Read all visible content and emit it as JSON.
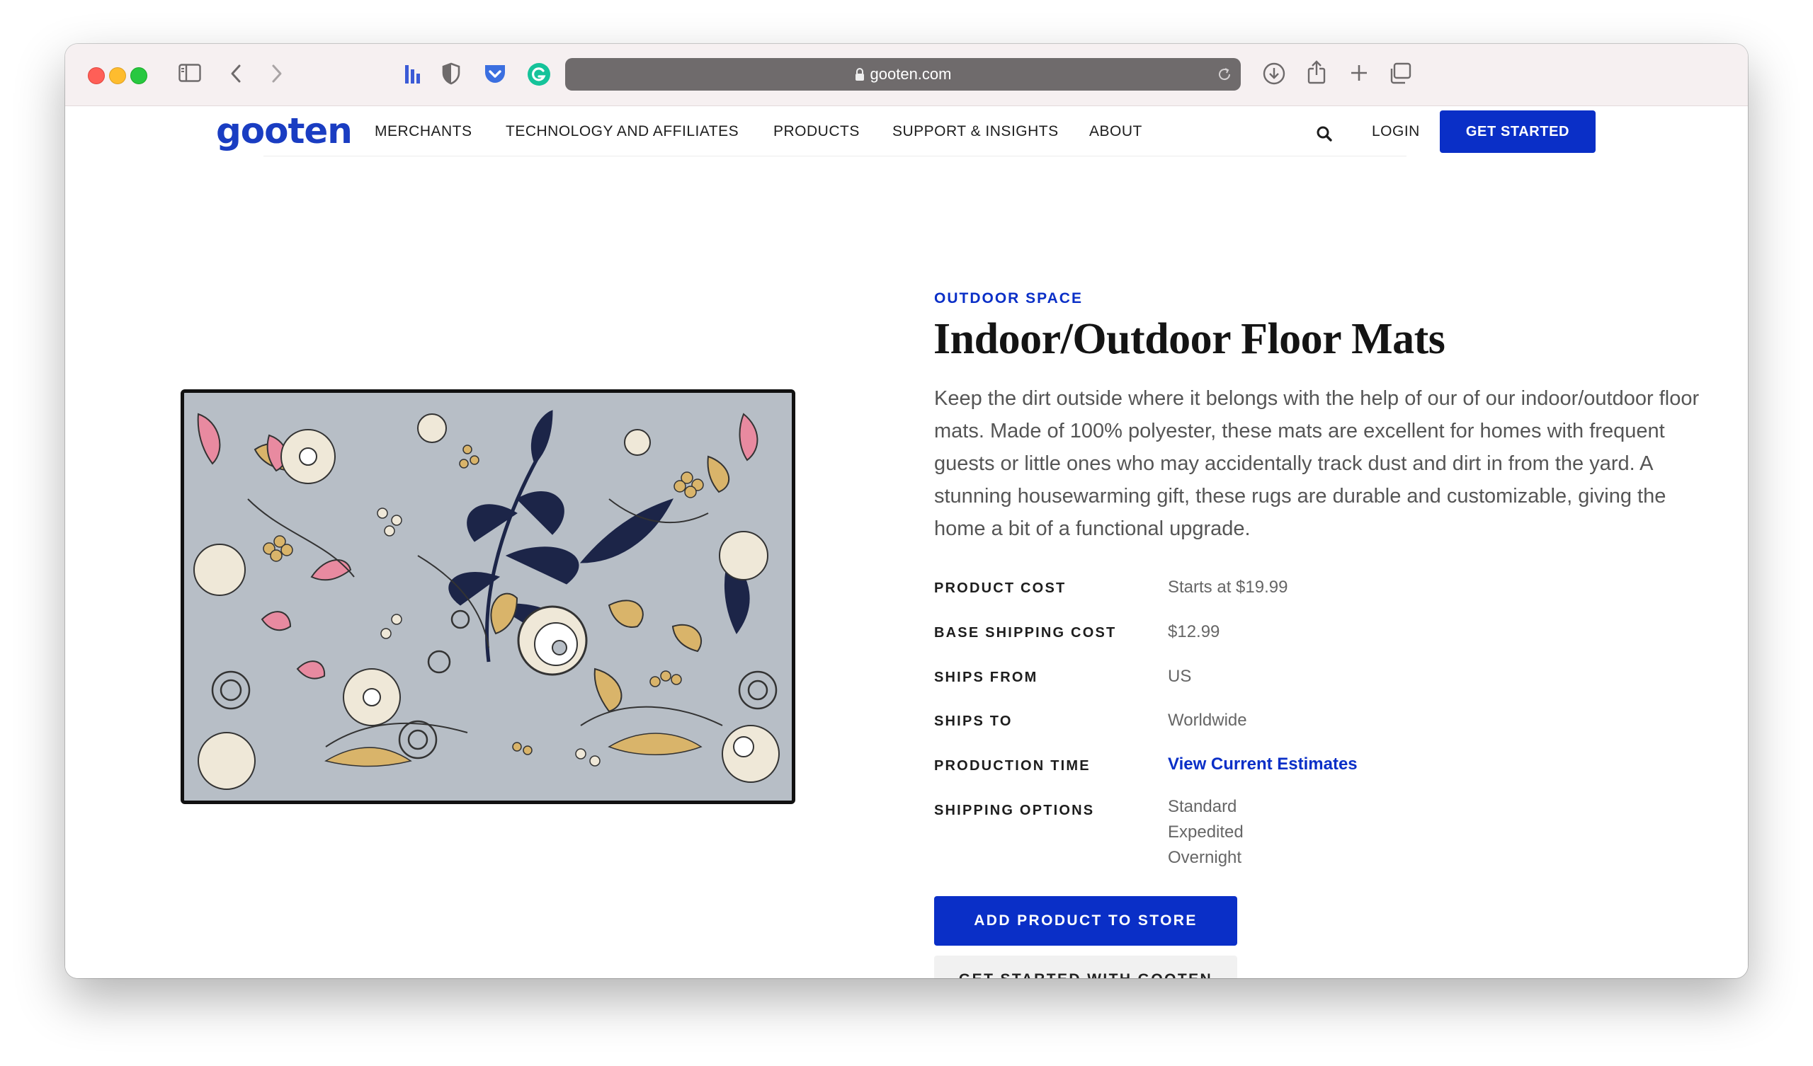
{
  "browser": {
    "url": "gooten.com",
    "icons": [
      "sidebar-icon",
      "back-icon",
      "forward-icon",
      "bookmark-icon",
      "shield-icon",
      "pocket-icon",
      "grammarly-icon",
      "lock-icon",
      "reload-icon",
      "download-icon",
      "share-icon",
      "new-tab-icon",
      "tabs-overview-icon"
    ]
  },
  "header": {
    "logo": "gooten",
    "nav": [
      "MERCHANTS",
      "TECHNOLOGY AND AFFILIATES",
      "PRODUCTS",
      "SUPPORT & INSIGHTS",
      "ABOUT"
    ],
    "login": "LOGIN",
    "cta": "GET STARTED"
  },
  "product": {
    "category": "OUTDOOR SPACE",
    "title": "Indoor/Outdoor Floor Mats",
    "description": "Keep the dirt outside where it belongs with the help of our of our indoor/outdoor floor mats. Made of 100% polyester, these mats are excellent for homes with frequent guests or little ones who may accidentally track dust and dirt in from the yard. A stunning housewarming gift, these rugs are durable and customizable, giving the home a bit of a functional upgrade.",
    "specs": [
      {
        "label": "PRODUCT COST",
        "value": "Starts at $19.99"
      },
      {
        "label": "BASE SHIPPING COST",
        "value": "$12.99"
      },
      {
        "label": "SHIPS FROM",
        "value": "US"
      },
      {
        "label": "SHIPS TO",
        "value": "Worldwide"
      },
      {
        "label": "PRODUCTION TIME",
        "value": "View Current Estimates"
      },
      {
        "label": "SHIPPING OPTIONS",
        "options": [
          "Standard",
          "Expedited",
          "Overnight"
        ]
      }
    ],
    "add_button": "ADD PRODUCT TO STORE",
    "secondary_button": "GET STARTED WITH GOOTEN",
    "colors": {
      "brand": "#0a2fc7",
      "mat_background": "#b7bec6",
      "navy": "#1c2548",
      "gold": "#d9b46a",
      "pink": "#e88aa0",
      "cream": "#efe8d8"
    }
  }
}
